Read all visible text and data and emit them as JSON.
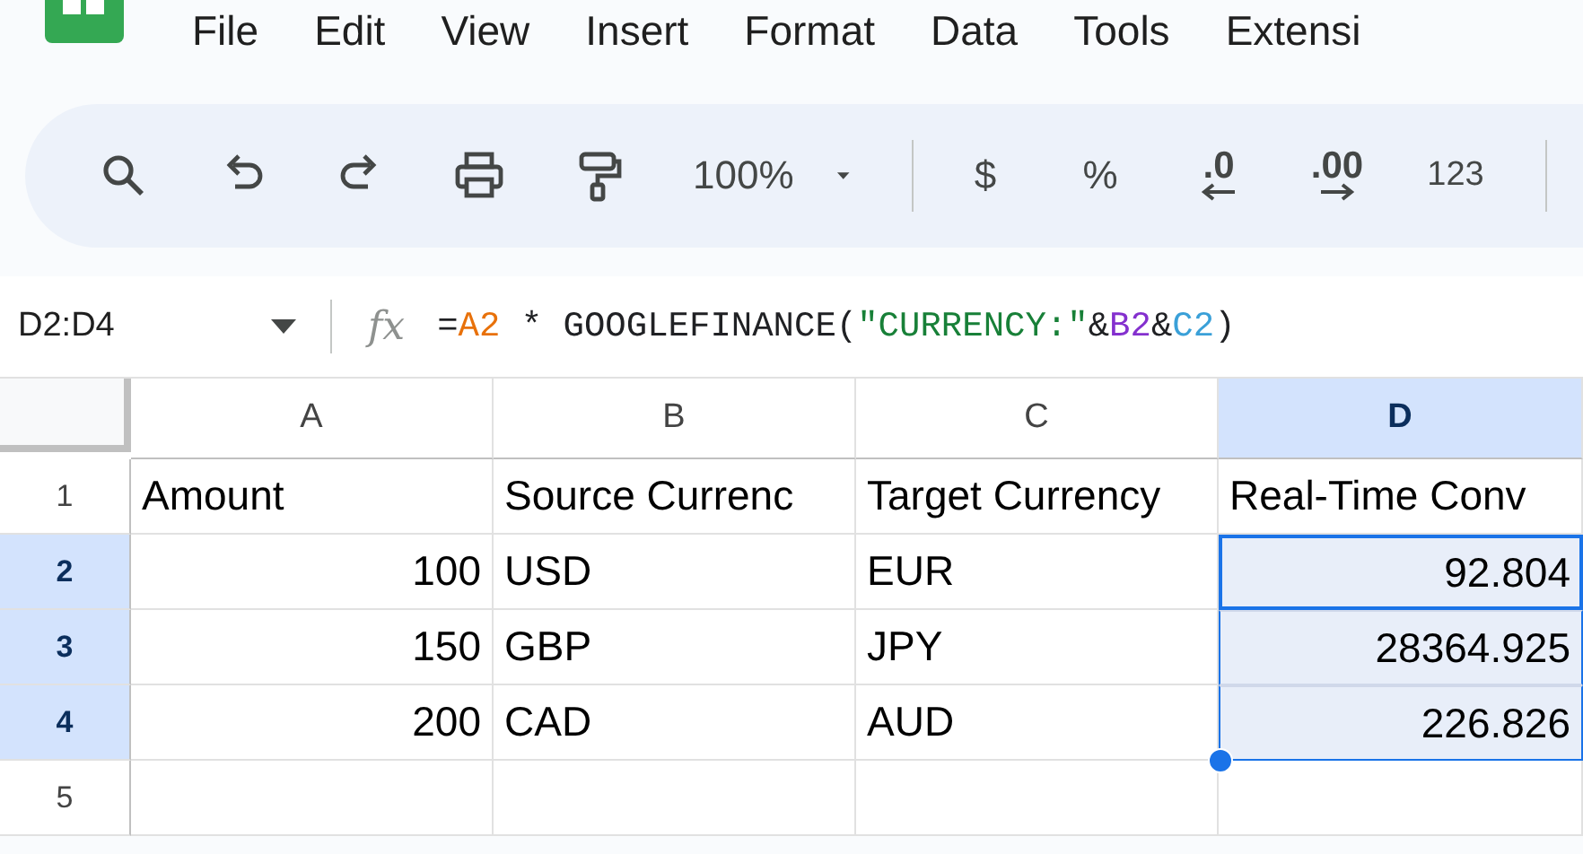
{
  "menu": [
    "File",
    "Edit",
    "View",
    "Insert",
    "Format",
    "Data",
    "Tools",
    "Extensi"
  ],
  "toolbar": {
    "zoom": "100%",
    "currency": "$",
    "percent": "%",
    "decrease_decimal": ".0",
    "increase_decimal": ".00",
    "number_format": "123"
  },
  "formula_bar": {
    "name_box": "D2:D4",
    "fx": "fx",
    "segments": [
      {
        "text": "=",
        "color": "#202124"
      },
      {
        "text": "A2",
        "color": "#e8710a"
      },
      {
        "text": " * GOOGLEFINANCE(",
        "color": "#202124"
      },
      {
        "text": "\"CURRENCY:\"",
        "color": "#188038"
      },
      {
        "text": "&",
        "color": "#202124"
      },
      {
        "text": "B2",
        "color": "#8430ce"
      },
      {
        "text": "&",
        "color": "#202124"
      },
      {
        "text": "C2",
        "color": "#3aa0d8"
      },
      {
        "text": ")",
        "color": "#202124"
      }
    ]
  },
  "columns": [
    {
      "label": "A",
      "selected": false
    },
    {
      "label": "B",
      "selected": false
    },
    {
      "label": "C",
      "selected": false
    },
    {
      "label": "D",
      "selected": true
    }
  ],
  "rows": [
    {
      "number": "1",
      "selected": false,
      "cells": [
        {
          "text": "Amount",
          "kind": "text",
          "selected": false,
          "active": false
        },
        {
          "text": "Source Currenc",
          "kind": "text",
          "selected": false,
          "active": false
        },
        {
          "text": "Target Currency",
          "kind": "text",
          "selected": false,
          "active": false
        },
        {
          "text": "Real-Time Conv",
          "kind": "text",
          "selected": false,
          "active": false
        }
      ]
    },
    {
      "number": "2",
      "selected": true,
      "cells": [
        {
          "text": "100",
          "kind": "number",
          "selected": false,
          "active": false
        },
        {
          "text": "USD",
          "kind": "text",
          "selected": false,
          "active": false
        },
        {
          "text": "EUR",
          "kind": "text",
          "selected": false,
          "active": false
        },
        {
          "text": "92.804",
          "kind": "number",
          "selected": true,
          "active": true
        }
      ]
    },
    {
      "number": "3",
      "selected": true,
      "cells": [
        {
          "text": "150",
          "kind": "number",
          "selected": false,
          "active": false
        },
        {
          "text": "GBP",
          "kind": "text",
          "selected": false,
          "active": false
        },
        {
          "text": "JPY",
          "kind": "text",
          "selected": false,
          "active": false
        },
        {
          "text": "28364.925",
          "kind": "number",
          "selected": true,
          "active": false
        }
      ]
    },
    {
      "number": "4",
      "selected": true,
      "cells": [
        {
          "text": "200",
          "kind": "number",
          "selected": false,
          "active": false
        },
        {
          "text": "CAD",
          "kind": "text",
          "selected": false,
          "active": false
        },
        {
          "text": "AUD",
          "kind": "text",
          "selected": false,
          "active": false
        },
        {
          "text": "226.826",
          "kind": "number",
          "selected": true,
          "active": false
        }
      ]
    },
    {
      "number": "5",
      "selected": false,
      "cells": [
        {
          "text": "",
          "kind": "text",
          "selected": false,
          "active": false
        },
        {
          "text": "",
          "kind": "text",
          "selected": false,
          "active": false
        },
        {
          "text": "",
          "kind": "text",
          "selected": false,
          "active": false
        },
        {
          "text": "",
          "kind": "text",
          "selected": false,
          "active": false
        }
      ]
    }
  ]
}
